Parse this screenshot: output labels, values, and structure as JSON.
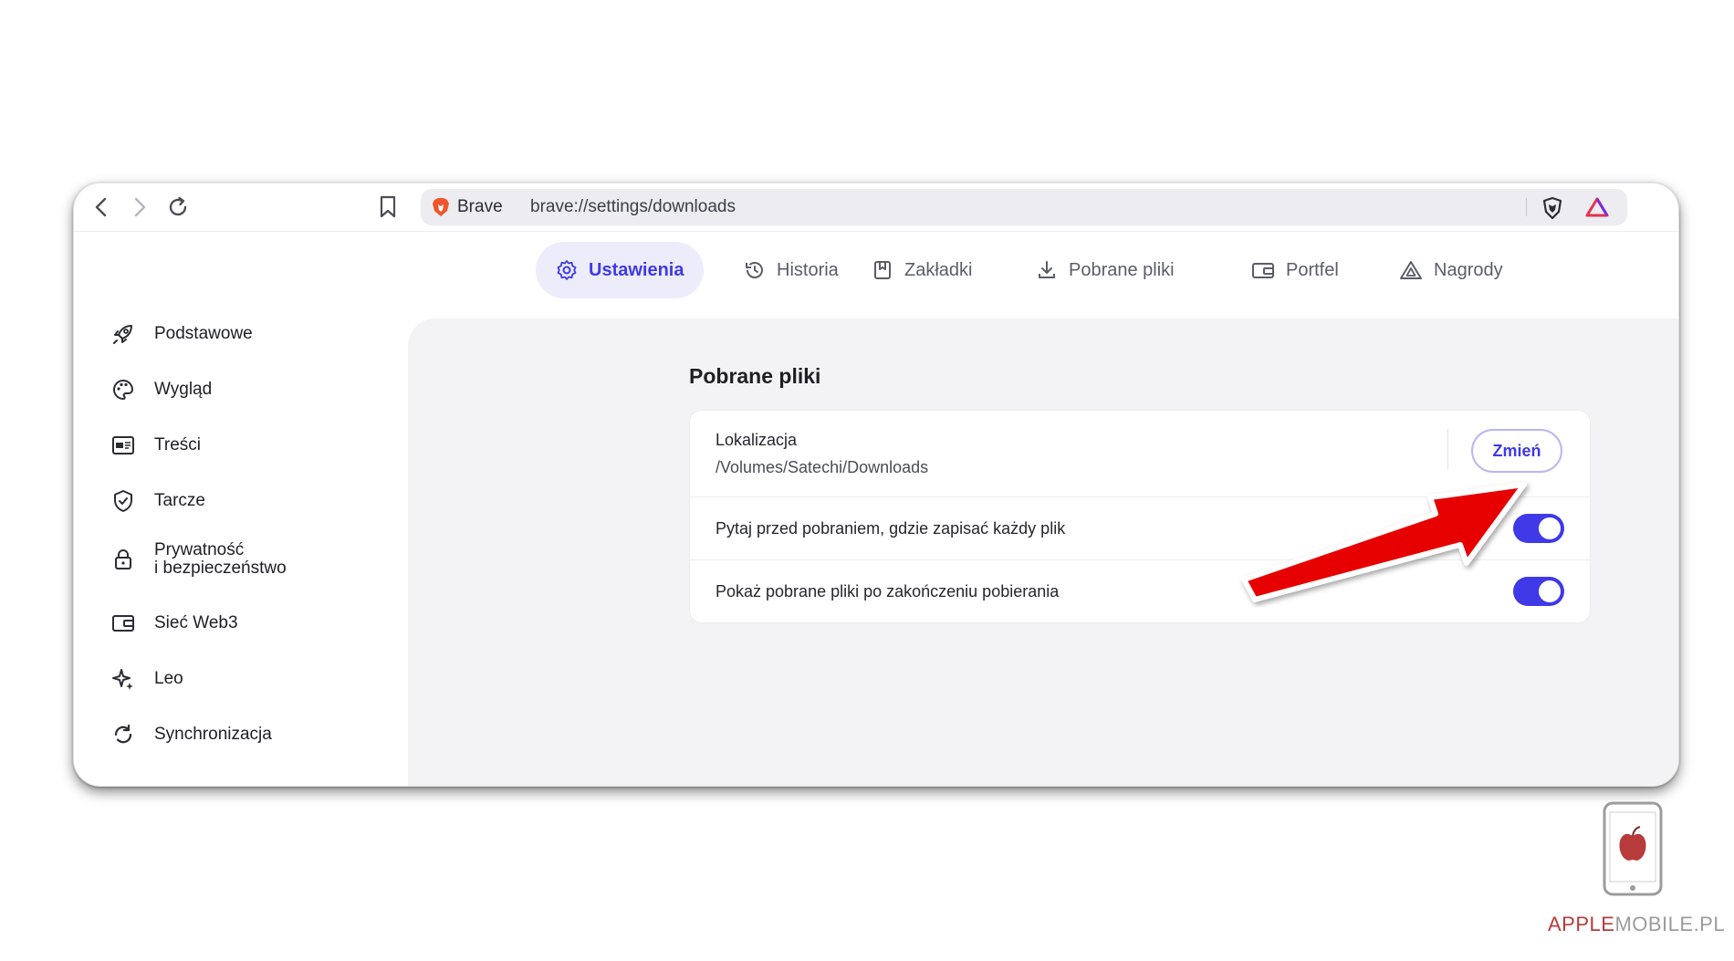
{
  "browser": {
    "brand_label": "Brave",
    "url": "brave://settings/downloads",
    "icons": [
      "back-icon",
      "forward-icon",
      "reload-icon",
      "bookmark-icon",
      "brave-lion-icon",
      "shields-icon",
      "rewards-icon"
    ]
  },
  "tabs": [
    {
      "label": "Ustawienia",
      "icon": "gear-icon",
      "active": true
    },
    {
      "label": "Historia",
      "icon": "history-icon",
      "active": false
    },
    {
      "label": "Zakładki",
      "icon": "bookmarks-icon",
      "active": false
    },
    {
      "label": "Pobrane pliki",
      "icon": "download-icon",
      "active": false
    },
    {
      "label": "Portfel",
      "icon": "wallet-icon",
      "active": false
    },
    {
      "label": "Nagrody",
      "icon": "rewards-icon",
      "active": false
    }
  ],
  "sidebar": {
    "items": [
      {
        "label": "Podstawowe",
        "icon": "rocket-icon"
      },
      {
        "label": "Wygląd",
        "icon": "palette-icon"
      },
      {
        "label": "Treści",
        "icon": "content-icon"
      },
      {
        "label": "Tarcze",
        "icon": "shield-check-icon"
      },
      {
        "label_line1": "Prywatność",
        "label_line2": "i bezpieczeństwo",
        "icon": "lock-icon"
      },
      {
        "label": "Sieć Web3",
        "icon": "wallet-icon"
      },
      {
        "label": "Leo",
        "icon": "sparkle-icon"
      },
      {
        "label": "Synchronizacja",
        "icon": "sync-icon"
      }
    ]
  },
  "downloads": {
    "title": "Pobrane pliki",
    "location_label": "Lokalizacja",
    "location_path": "/Volumes/Satechi/Downloads",
    "change_button": "Zmień",
    "ask_where_label": "Pytaj przed pobraniem, gdzie zapisać każdy plik",
    "ask_where_enabled": true,
    "show_when_done_label": "Pokaż pobrane pliki po zakończeniu pobierania",
    "show_when_done_enabled": true
  },
  "watermark": {
    "part1": "APPLE",
    "part2": "MOBILE.PL"
  },
  "colors": {
    "accent": "#3f39e8",
    "active_tab_bg": "#ececfb",
    "content_bg": "#f3f3f5",
    "arrow": "#e60000"
  }
}
